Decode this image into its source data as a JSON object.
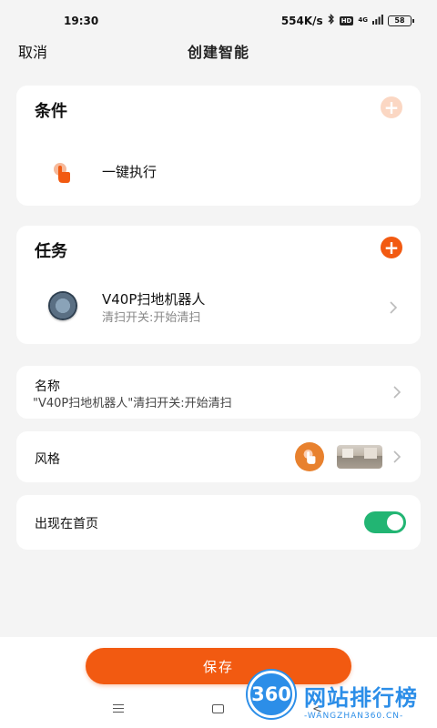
{
  "status_bar": {
    "time": "19:30",
    "speed": "554K/s",
    "hd": "HD",
    "signal": "4G",
    "battery": "58"
  },
  "header": {
    "cancel_label": "取消",
    "title": "创建智能"
  },
  "conditions": {
    "title": "条件",
    "items": [
      {
        "label": "一键执行",
        "icon": "tap-hand-icon"
      }
    ]
  },
  "tasks": {
    "title": "任务",
    "items": [
      {
        "device": "V40P扫地机器人",
        "action": "清扫开关:开始清扫",
        "icon": "robot-vacuum-icon"
      }
    ]
  },
  "name_row": {
    "label": "名称",
    "value": "\"V40P扫地机器人\"清扫开关:开始清扫"
  },
  "style_row": {
    "label": "风格"
  },
  "home_row": {
    "label": "出现在首页",
    "toggle_on": true
  },
  "save_label": "保存",
  "watermark": {
    "badge": "360",
    "text": "网站排行榜",
    "sub": "-WANGZHAN360.CN-"
  },
  "colors": {
    "accent": "#f25a11",
    "toggle": "#22b573",
    "watermark": "#2c8ee8"
  }
}
